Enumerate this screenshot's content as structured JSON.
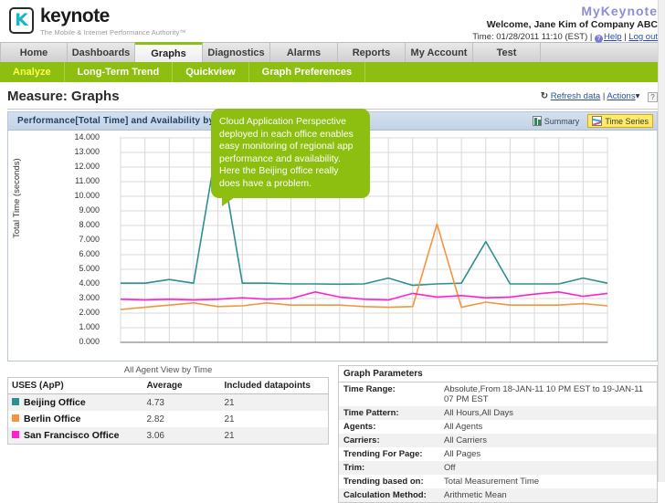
{
  "brand": {
    "name": "keynote",
    "tagline": "The Mobile & Internet Performance Authority™",
    "mark_letter": "K"
  },
  "account": {
    "product": "MyKeynote",
    "welcome": "Welcome, Jane Kim of Company ABC",
    "time": "Time: 01/28/2011 11:10 (EST)",
    "sep": "|",
    "help": "Help",
    "logout": "Log out"
  },
  "nav": {
    "items": [
      {
        "label": "Home",
        "active": false
      },
      {
        "label": "Dashboards",
        "active": false
      },
      {
        "label": "Graphs",
        "active": true
      },
      {
        "label": "Diagnostics",
        "active": false
      },
      {
        "label": "Alarms",
        "active": false
      },
      {
        "label": "Reports",
        "active": false
      },
      {
        "label": "My Account",
        "active": false
      },
      {
        "label": "Test",
        "active": false
      }
    ]
  },
  "subnav": {
    "items": [
      {
        "label": "Analyze",
        "active": true
      },
      {
        "label": "Long-Term Trend",
        "active": false
      },
      {
        "label": "Quickview",
        "active": false
      },
      {
        "label": "Graph Preferences",
        "active": false
      }
    ]
  },
  "page": {
    "title": "Measure: Graphs",
    "refresh": "Refresh data",
    "refresh_glyph": "↻",
    "sep": "|",
    "actions": "Actions",
    "actions_caret": "▾",
    "help_box": "?"
  },
  "panel": {
    "title": "Performance[Total Time] and Availability by Agent",
    "buttons": [
      {
        "label": "Summary",
        "selected": false,
        "icon": "summary-icon"
      },
      {
        "label": "Time Series",
        "selected": true,
        "icon": "time-series-icon"
      }
    ]
  },
  "callout": {
    "text": "Cloud Application Perspective deployed in each office enables easy monitoring of regional app performance and availability. Here the Beijing office really does have a problem.",
    "color": "#8cbf0f"
  },
  "chart_data": {
    "type": "line",
    "title": "Performance[Total Time] and Availability by Agent",
    "xlabel": "",
    "ylabel": "Total Time (seconds)",
    "ylim": [
      0,
      14
    ],
    "yticks": [
      "14.000",
      "13.000",
      "12.000",
      "11.000",
      "10.000",
      "9.000",
      "8.000",
      "7.000",
      "6.000",
      "5.000",
      "4.000",
      "3.000",
      "2.000",
      "1.000",
      "0.000"
    ],
    "grid": true,
    "legend_position": "below-table",
    "x": [
      1,
      2,
      3,
      4,
      5,
      6,
      7,
      8,
      9,
      10,
      11,
      12,
      13,
      14,
      15,
      16,
      17,
      18,
      19,
      20,
      21
    ],
    "series": [
      {
        "name": "Beijing Office",
        "color": "#2e8f8f",
        "values": [
          4.05,
          4.05,
          4.3,
          4.05,
          13.9,
          4.05,
          4.05,
          4.0,
          4.0,
          3.98,
          4.0,
          4.4,
          3.9,
          4.0,
          4.05,
          6.9,
          4.0,
          4.0,
          4.0,
          4.4,
          4.05
        ]
      },
      {
        "name": "Berlin Office",
        "color": "#f5943c",
        "values": [
          2.25,
          2.4,
          2.55,
          2.7,
          2.45,
          2.5,
          2.7,
          2.55,
          2.55,
          2.55,
          2.45,
          2.4,
          2.45,
          8.1,
          2.4,
          2.75,
          2.55,
          2.55,
          2.55,
          2.65,
          2.5
        ]
      },
      {
        "name": "San Francisco Office",
        "color": "#ff22cc",
        "values": [
          2.95,
          2.9,
          2.95,
          2.9,
          2.95,
          3.05,
          2.95,
          3.0,
          3.45,
          3.1,
          2.95,
          2.9,
          3.35,
          3.1,
          3.2,
          3.05,
          3.1,
          3.3,
          3.45,
          3.15,
          3.35
        ]
      }
    ]
  },
  "agent_table": {
    "caption": "All Agent View by Time",
    "headers": [
      "USES (ApP)",
      "Average",
      "Included datapoints"
    ],
    "rows": [
      {
        "color": "#2e8f8f",
        "name": "Beijing Office",
        "average": "4.73",
        "datapoints": "21"
      },
      {
        "color": "#f5943c",
        "name": "Berlin Office",
        "average": "2.82",
        "datapoints": "21"
      },
      {
        "color": "#ff22cc",
        "name": "San Francisco Office",
        "average": "3.06",
        "datapoints": "21"
      }
    ]
  },
  "graph_parameters": {
    "title": "Graph Parameters",
    "rows": [
      {
        "key": "Time Range:",
        "value": "Absolute,From 18-JAN-11 10 PM EST to 19-JAN-11 07 PM EST"
      },
      {
        "key": "Time Pattern:",
        "value": "All Hours,All Days"
      },
      {
        "key": "Agents:",
        "value": "All Agents"
      },
      {
        "key": "Carriers:",
        "value": "All Carriers"
      },
      {
        "key": "Trending For Page:",
        "value": "All Pages"
      },
      {
        "key": "Trim:",
        "value": "Off"
      },
      {
        "key": "Trending based on:",
        "value": "Total Measurement Time"
      },
      {
        "key": "Calculation Method:",
        "value": "Arithmetic Mean"
      }
    ]
  }
}
